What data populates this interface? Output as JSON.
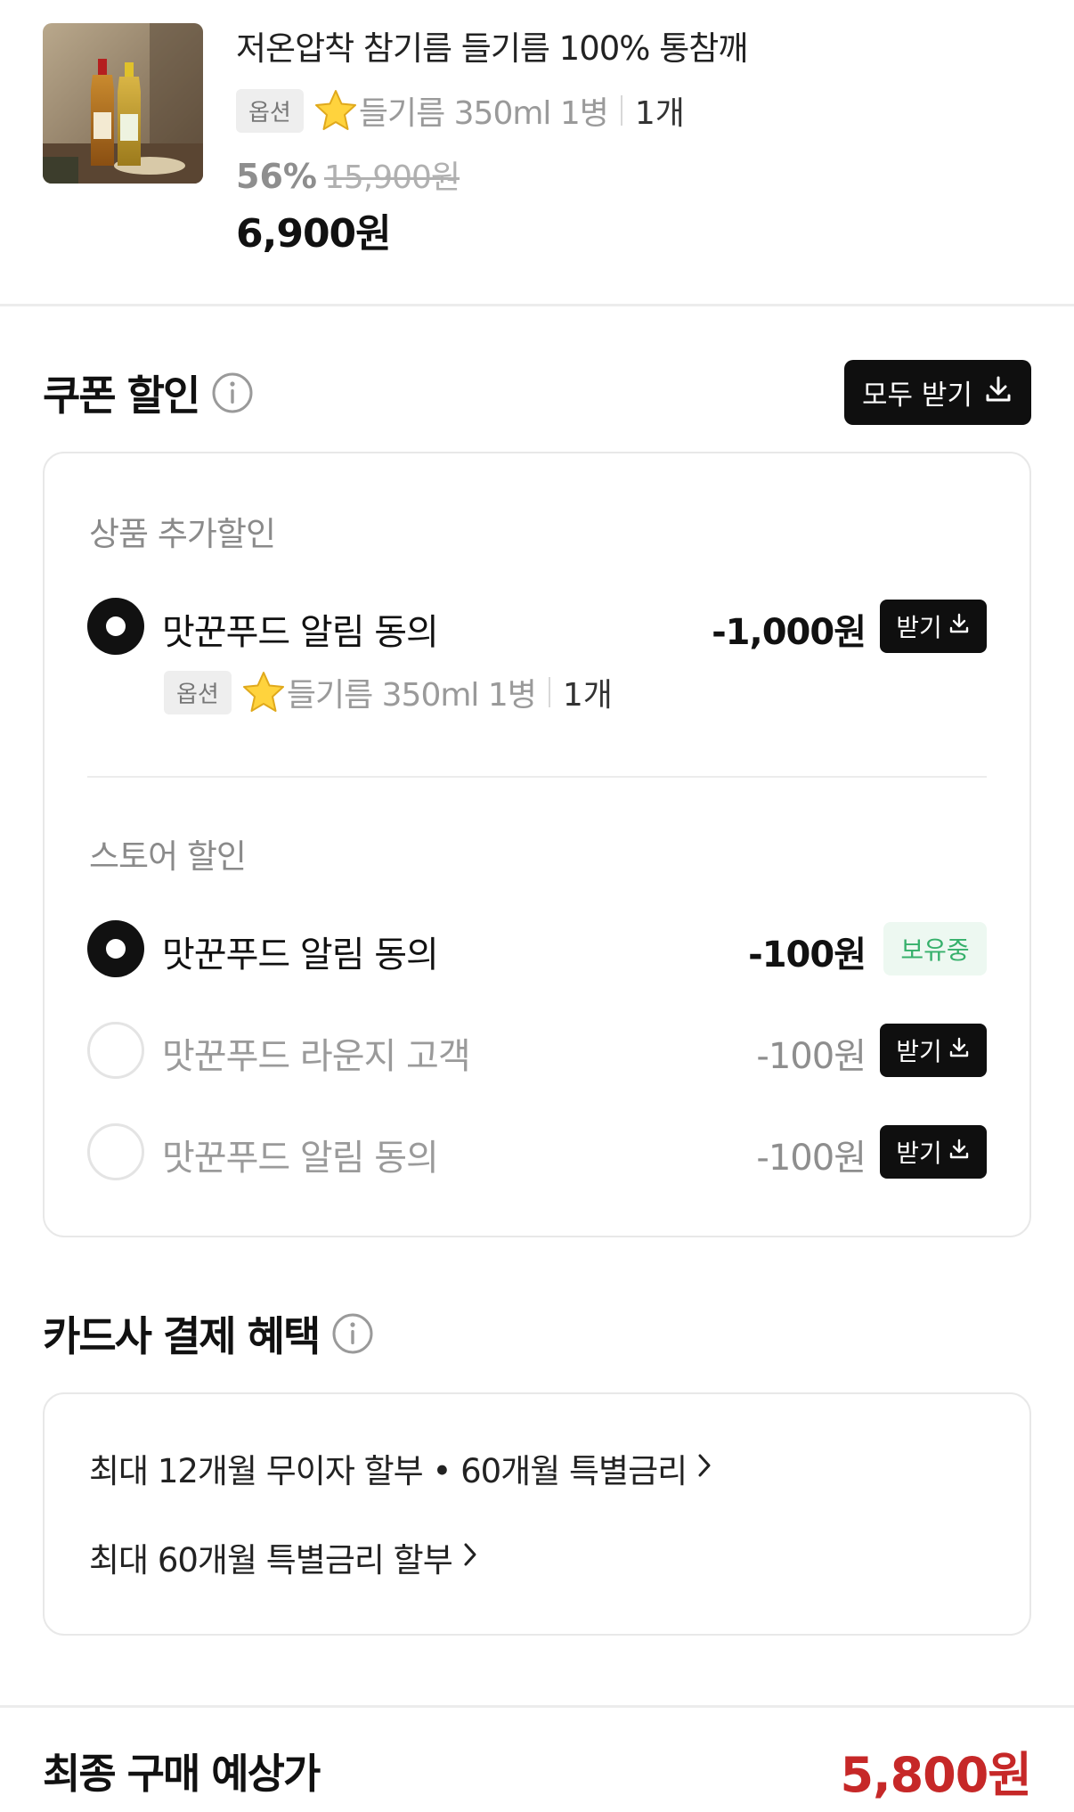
{
  "product": {
    "name": "저온압착 참기름 들기름 100% 통참깨",
    "option_chip": "옵션",
    "option_text": "들기름 350ml 1병",
    "quantity": "1개",
    "discount_percent": "56%",
    "original_price": "15,900원",
    "price": "6,900원"
  },
  "coupon": {
    "title": "쿠폰 할인",
    "download_all_label": "모두 받기",
    "product_group": {
      "label": "상품 추가할인",
      "items": [
        {
          "name": "맛꾼푸드 알림 동의",
          "amount": "-1,000원",
          "selected": true,
          "action": "받기",
          "option_chip": "옵션",
          "option_text": "들기름 350ml 1병",
          "quantity": "1개"
        }
      ]
    },
    "store_group": {
      "label": "스토어 할인",
      "items": [
        {
          "name": "맛꾼푸드 알림 동의",
          "amount": "-100원",
          "selected": true,
          "status": "보유중"
        },
        {
          "name": "맛꾼푸드 라운지 고객",
          "amount": "-100원",
          "selected": false,
          "action": "받기"
        },
        {
          "name": "맛꾼푸드 알림 동의",
          "amount": "-100원",
          "selected": false,
          "action": "받기"
        }
      ]
    }
  },
  "card_benefits": {
    "title": "카드사 결제 혜택",
    "items": [
      "최대 12개월 무이자 할부 • 60개월 특별금리",
      "최대 60개월 특별금리 할부"
    ]
  },
  "final": {
    "label": "최종 구매 예상가",
    "price": "5,800원"
  },
  "colors": {
    "accent_price": "#c62828",
    "button_dark": "#0f0f0f",
    "owned_badge_text": "#36b06b",
    "owned_badge_bg": "#edf8f1"
  },
  "icons": {
    "info": "info-circle-icon",
    "download": "download-icon",
    "chevron": "chevron-right-icon",
    "star": "star-icon"
  }
}
